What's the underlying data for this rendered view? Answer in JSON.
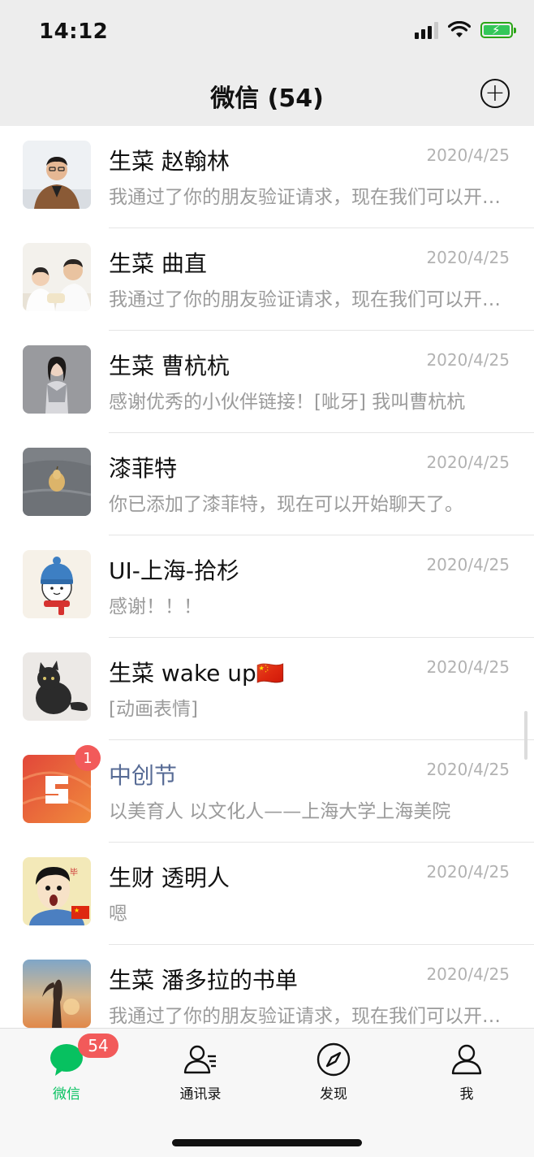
{
  "status_bar": {
    "time": "14:12"
  },
  "header": {
    "title": "微信 (54)",
    "plus_icon": "plus-circle-icon"
  },
  "chats": [
    {
      "name": "生菜 赵翰林",
      "date": "2020/4/25",
      "preview": "我通过了你的朋友验证请求，现在我们可以开始聊天了",
      "official": false
    },
    {
      "name": "生菜 曲直",
      "date": "2020/4/25",
      "preview": "我通过了你的朋友验证请求，现在我们可以开始聊天了",
      "official": false
    },
    {
      "name": "生菜 曹杭杭",
      "date": "2020/4/25",
      "preview": "感谢优秀的小伙伴链接！[呲牙] 我叫曹杭杭",
      "official": false
    },
    {
      "name": "漆菲特",
      "date": "2020/4/25",
      "preview": "你已添加了漆菲特，现在可以开始聊天了。",
      "official": false
    },
    {
      "name": "UI-上海-拾杉",
      "date": "2020/4/25",
      "preview": "感谢！！！",
      "official": false
    },
    {
      "name": "生菜 wake up🇨🇳",
      "date": "2020/4/25",
      "preview": "[动画表情]",
      "official": false
    },
    {
      "name": "中创节",
      "date": "2020/4/25",
      "preview": "以美育人 以文化人——上海大学上海美院",
      "official": true,
      "badge": "1"
    },
    {
      "name": "生财 透明人",
      "date": "2020/4/25",
      "preview": "嗯",
      "official": false
    },
    {
      "name": "生菜 潘多拉的书单",
      "date": "2020/4/25",
      "preview": "我通过了你的朋友验证请求，现在我们可以开始聊天了",
      "official": false
    }
  ],
  "tabbar": {
    "tabs": [
      {
        "label": "微信",
        "icon": "chat-bubble-icon",
        "active": true,
        "badge": "54"
      },
      {
        "label": "通讯录",
        "icon": "contacts-icon",
        "active": false
      },
      {
        "label": "发现",
        "icon": "compass-icon",
        "active": false
      },
      {
        "label": "我",
        "icon": "person-icon",
        "active": false
      }
    ]
  },
  "colors": {
    "accent": "#07c160",
    "badge": "#f25a5a",
    "official_name": "#576b95"
  }
}
